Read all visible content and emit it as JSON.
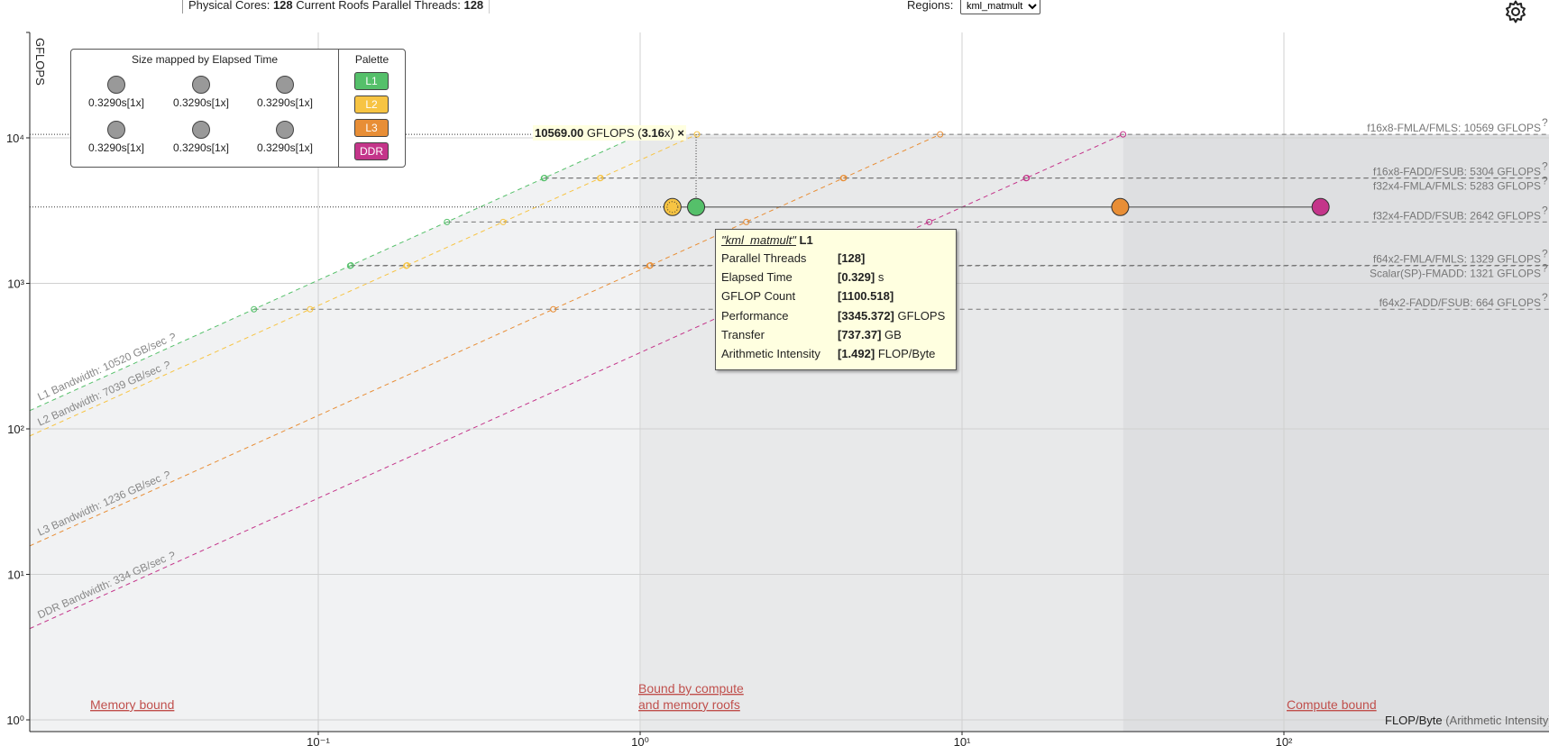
{
  "top_bar": {
    "physical_cores_label": "Physical Cores:",
    "physical_cores_value": "128",
    "threads_label": "Current Roofs Parallel Threads:",
    "threads_value": "128",
    "regions_label": "Regions:",
    "regions_selected": "kml_matmult"
  },
  "settings": {
    "icon": "gear-icon"
  },
  "legend": {
    "size_title": "Size mapped by Elapsed Time",
    "size_values": [
      "0.3290s[1x]",
      "0.3290s[1x]",
      "0.3290s[1x]",
      "0.3290s[1x]",
      "0.3290s[1x]",
      "0.3290s[1x]"
    ],
    "palette_title": "Palette",
    "palette": [
      {
        "label": "L1",
        "color": "#55c06a"
      },
      {
        "label": "L2",
        "color": "#f7c443"
      },
      {
        "label": "L3",
        "color": "#e88e36"
      },
      {
        "label": "DDR",
        "color": "#c4358a"
      }
    ]
  },
  "peak_label": {
    "value": "10569.00",
    "unit": "GFLOPS",
    "open": "(",
    "ratio": "3.16",
    "ratio_suffix": "x)",
    "marker": "×"
  },
  "tooltip": {
    "region_name": "\"kml_matmult\"",
    "level": "L1",
    "rows": [
      {
        "key": "Parallel Threads",
        "value": "[128]",
        "unit": ""
      },
      {
        "key": "Elapsed Time",
        "value": "[0.329]",
        "unit": "s"
      },
      {
        "key": "GFLOP Count",
        "value": "[1100.518]",
        "unit": ""
      },
      {
        "key": "Performance",
        "value": "[3345.372]",
        "unit": "GFLOPS"
      },
      {
        "key": "Transfer",
        "value": "[737.37]",
        "unit": "GB"
      },
      {
        "key": "Arithmetic Intensity",
        "value": "[1.492]",
        "unit": "FLOP/Byte"
      }
    ]
  },
  "regions": {
    "memory_bound": "Memory bound",
    "compute_memory_bound_line1": "Bound by compute",
    "compute_memory_bound_line2": "and memory roofs",
    "compute_bound": "Compute bound"
  },
  "xaxis_title": {
    "main": "FLOP/Byte",
    "sub": "(Arithmetic Intensity)"
  },
  "chart_data": {
    "type": "scatter",
    "title": "",
    "xscale": "log",
    "yscale": "log",
    "xlim": [
      0.01,
      170
    ],
    "ylim": [
      0.8,
      40000
    ],
    "ylabel": "GFLOPS",
    "xlabel": "FLOP/Byte (Arithmetic Intensity)",
    "x_tick_labels": [
      {
        "value": 0.1,
        "label": "10⁻¹"
      },
      {
        "value": 1,
        "label": "10⁰"
      },
      {
        "value": 10,
        "label": "10¹"
      },
      {
        "value": 100,
        "label": "10²"
      }
    ],
    "y_tick_labels": [
      {
        "value": 1,
        "label": "10⁰"
      },
      {
        "value": 10,
        "label": "10¹"
      },
      {
        "value": 100,
        "label": "10²"
      },
      {
        "value": 1000,
        "label": "10³"
      },
      {
        "value": 10000,
        "label": "10⁴"
      }
    ],
    "grid": true,
    "compute_roofs": [
      {
        "label": "f16x8-FMLA/FMLS: 10569 GFLOPS",
        "gflops": 10569
      },
      {
        "label": "f16x8-FADD/FSUB: 5304 GFLOPS",
        "gflops": 5304
      },
      {
        "label": "f32x4-FMLA/FMLS: 5283 GFLOPS",
        "gflops": 5283
      },
      {
        "label": "f32x4-FADD/FSUB: 2642 GFLOPS",
        "gflops": 2642
      },
      {
        "label": "f64x2-FMLA/FMLS: 1329 GFLOPS",
        "gflops": 1329
      },
      {
        "label": "Scalar(SP)-FMADD: 1321 GFLOPS",
        "gflops": 1321
      },
      {
        "label": "f64x2-FADD/FSUB: 664 GFLOPS",
        "gflops": 664
      }
    ],
    "memory_roofs": [
      {
        "label": "L1 Bandwidth: 10520 GB/sec",
        "gbps": 10520,
        "color": "#55c06a"
      },
      {
        "label": "L2 Bandwidth: 7039 GB/sec",
        "gbps": 7039,
        "color": "#f7c443"
      },
      {
        "label": "L3 Bandwidth: 1236 GB/sec",
        "gbps": 1236,
        "color": "#e88e36"
      },
      {
        "label": "DDR Bandwidth: 334 GB/sec",
        "gbps": 334,
        "color": "#c4358a"
      }
    ],
    "points": [
      {
        "level": "L1",
        "ai": 1.492,
        "gflops": 3345.372,
        "color": "#55c06a"
      },
      {
        "level": "L2",
        "ai": 1.26,
        "gflops": 3345.372,
        "color": "#f7c443"
      },
      {
        "level": "L3",
        "ai": 31,
        "gflops": 3345.372,
        "color": "#e88e36"
      },
      {
        "level": "DDR",
        "ai": 130,
        "gflops": 3345.372,
        "color": "#c4358a"
      }
    ],
    "peak_performance": 10569,
    "peak_ratio": 3.16
  }
}
